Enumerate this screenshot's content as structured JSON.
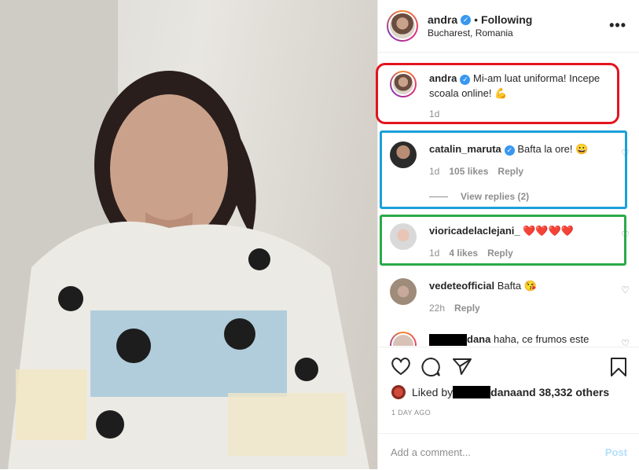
{
  "post": {
    "username": "andra",
    "follow_state": "Following",
    "location": "Bucharest, Romania",
    "more_label": "•••",
    "caption": {
      "username": "andra",
      "text": "Mi-am luat uniforma! Incepe scoala online! 💪",
      "time": "1d"
    }
  },
  "comments": [
    {
      "username": "catalin_maruta",
      "verified": true,
      "text": "Bafta la ore! 😀",
      "time": "1d",
      "likes": "105 likes",
      "reply": "Reply",
      "view_replies": "View replies (2)"
    },
    {
      "username": "vioricadelaclejani_",
      "text": "❤️❤️❤️❤️",
      "time": "1d",
      "likes": "4 likes",
      "reply": "Reply"
    },
    {
      "username": "vedeteofficial",
      "text": "Bafta 😘",
      "time": "22h",
      "reply": "Reply"
    },
    {
      "username": "dana",
      "text": "haha, ce frumos este",
      "username_partial_redacted": true
    }
  ],
  "liked_by": {
    "prefix": "Liked by ",
    "name": "dana",
    "rest": " and 38,332 others"
  },
  "time_ago": "1 DAY AGO",
  "add_comment": {
    "placeholder": "Add a comment...",
    "post_label": "Post"
  },
  "highlight_colors": {
    "caption": "#e3141e",
    "comment1": "#1aa0d8",
    "comment2": "#2aaa4a"
  }
}
